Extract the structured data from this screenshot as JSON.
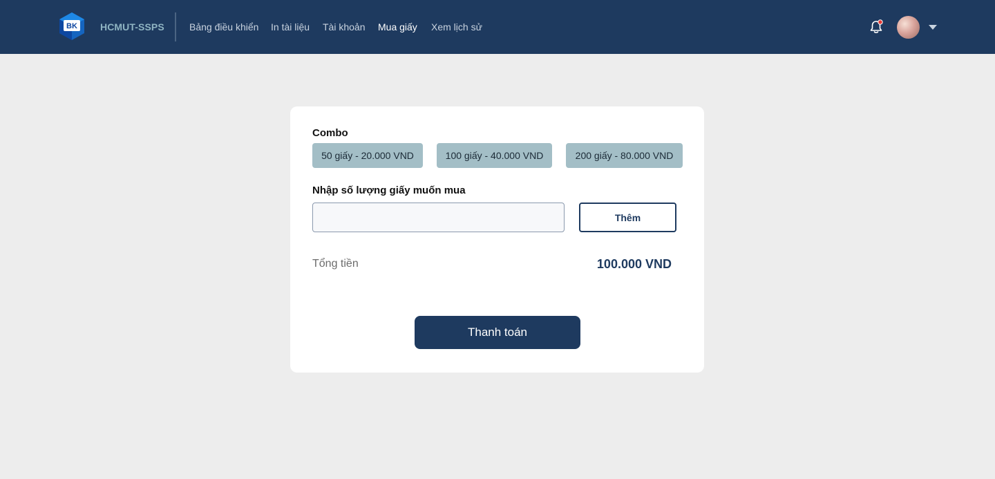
{
  "nav": {
    "brand": "HCMUT-SSPS",
    "logo_text": "BK",
    "items": [
      {
        "label": "Bảng điều khiển",
        "active": false
      },
      {
        "label": "In tài liệu",
        "active": false
      },
      {
        "label": "Tài khoản",
        "active": false
      },
      {
        "label": "Mua giấy",
        "active": true
      },
      {
        "label": "Xem lịch sử",
        "active": false
      }
    ],
    "bell_icon": "bell-icon",
    "has_notification": true
  },
  "form": {
    "combo_label": "Combo",
    "combos": [
      "50 giấy - 20.000 VND",
      "100 giấy - 40.000 VND",
      "200 giấy - 80.000 VND"
    ],
    "qty_label": "Nhập số lượng giấy muốn mua",
    "qty_value": "",
    "add_label": "Thêm",
    "total_label": "Tổng tiền",
    "total_value": "100.000 VND",
    "pay_label": "Thanh toán"
  },
  "colors": {
    "navbar": "#1e3a5f",
    "combo_bg": "#a3bec6",
    "brand": "#8fb4c2",
    "page_bg": "#ededed"
  }
}
